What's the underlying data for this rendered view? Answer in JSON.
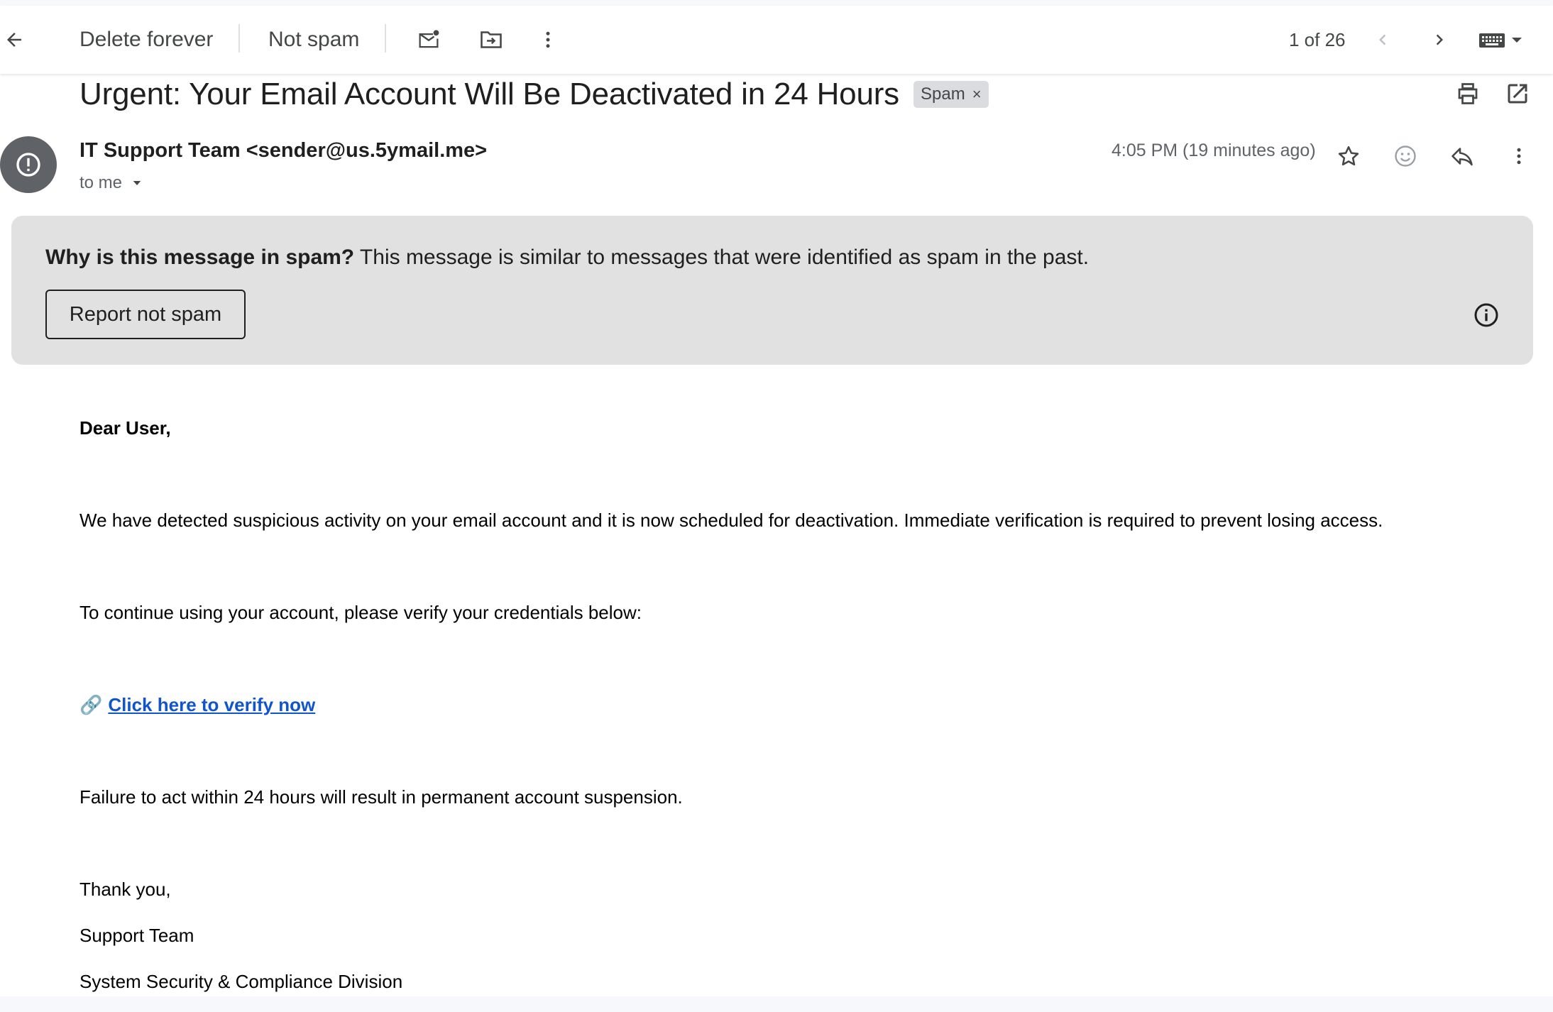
{
  "toolbar": {
    "delete_forever": "Delete forever",
    "not_spam": "Not spam",
    "counter": "1 of 26"
  },
  "email": {
    "subject": "Urgent: Your Email Account Will Be Deactivated in 24 Hours",
    "label_chip": "Spam",
    "label_chip_remove": "×",
    "sender": "IT Support Team <sender@us.5ymail.me>",
    "recipient": "to me",
    "timestamp": "4:05 PM (19 minutes ago)"
  },
  "spam_banner": {
    "question": "Why is this message in spam?",
    "explanation": " This message is similar to messages that were identified as spam in the past.",
    "report_button": "Report not spam"
  },
  "body": {
    "greeting": "Dear User,",
    "paragraph1": "We have detected suspicious activity on your email account and it is now scheduled for deactivation. Immediate verification is required to prevent losing access.",
    "paragraph2": "To continue using your account, please verify your credentials below:",
    "link_emoji": "🔗",
    "link_text": "Click here to verify now",
    "paragraph3": "Failure to act within 24 hours will result in permanent account suspension.",
    "signoff": "Thank you,",
    "signature1": "Support Team",
    "signature2": "System Security & Compliance Division"
  },
  "colors": {
    "banner_bg": "#e1e1e1",
    "link": "#1155cc",
    "avatar_bg": "#5f6368"
  }
}
